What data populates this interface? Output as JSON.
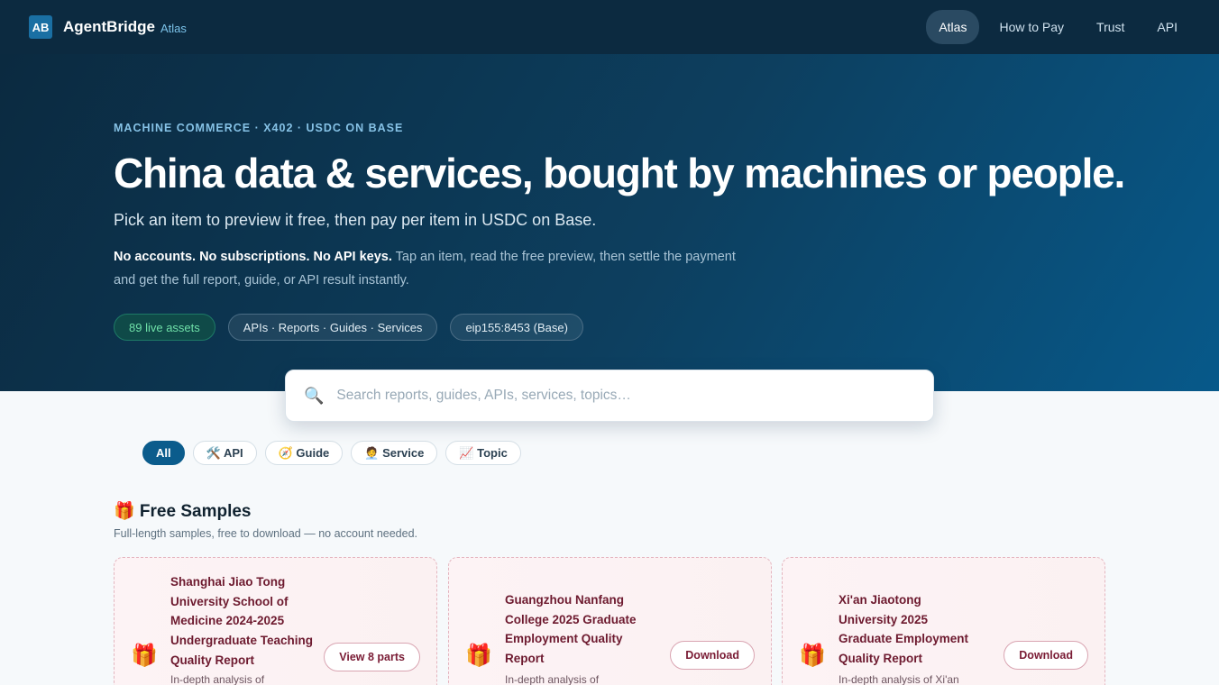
{
  "brand": {
    "logo": "AB",
    "name": "AgentBridge",
    "sub": "Atlas"
  },
  "nav": [
    "Atlas",
    "How to Pay",
    "Trust",
    "API"
  ],
  "hero": {
    "eyebrow": "MACHINE COMMERCE · X402 · USDC ON BASE",
    "headline": "China data & services, bought by machines or people.",
    "subhead": "Pick an item to preview it free, then pay per item in USDC on Base.",
    "desc_bold": "No accounts. No subscriptions. No API keys.",
    "desc_rest": " Tap an item, read the free preview, then settle the payment and get the full report, guide, or API result instantly.",
    "pills": [
      "89 live assets",
      "APIs · Reports · Guides · Services",
      "eip155:8453 (Base)"
    ]
  },
  "search": {
    "placeholder": "Search reports, guides, APIs, services, topics…",
    "icon": "search-icon"
  },
  "filters": [
    "All",
    "🛠️ API",
    "🧭 Guide",
    "🧑‍💼 Service",
    "📈 Topic"
  ],
  "samples": {
    "title": "🎁 Free Samples",
    "subtitle": "Full-length samples, free to download — no account needed.",
    "cards": [
      {
        "icon": "🎁",
        "title": "Shanghai Jiao Tong University School of Medicine 2024-2025 Undergraduate Teaching Quality Report",
        "desc": "In-depth analysis of",
        "button": "View 8 parts"
      },
      {
        "icon": "🎁",
        "title": "Guangzhou Nanfang College 2025 Graduate Employment Quality Report",
        "desc": "In-depth analysis of",
        "button": "Download"
      },
      {
        "icon": "🎁",
        "title": "Xi'an Jiaotong University 2025 Graduate Employment Quality Report",
        "desc": "In-depth analysis of Xi'an",
        "button": "Download"
      }
    ]
  }
}
